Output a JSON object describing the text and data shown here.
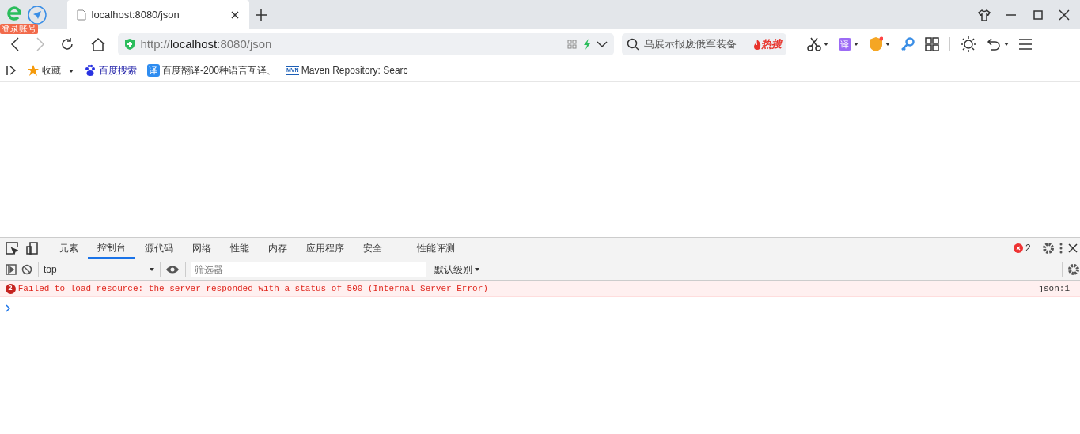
{
  "browser": {
    "account_badge": "登录账号",
    "tabs": [
      {
        "title": "localhost:8080/json",
        "selected": true
      }
    ],
    "address": {
      "prefix": "http://",
      "host": "localhost",
      "suffix": ":8080/json"
    },
    "search": {
      "placeholder": "乌展示报废俄军装备",
      "hot_label": "热搜"
    },
    "translate_glyph": "译",
    "bookmarks": [
      {
        "kind": "folder",
        "label": "收藏"
      },
      {
        "kind": "baidu",
        "label": "百度搜索"
      },
      {
        "kind": "translate",
        "icon_text": "译",
        "label": "百度翻译-200种语言互译、"
      },
      {
        "kind": "maven",
        "icon_text": "MVN",
        "label": "Maven Repository: Searc"
      }
    ]
  },
  "devtools": {
    "tabs": [
      {
        "label": "元素",
        "selected": false
      },
      {
        "label": "控制台",
        "selected": true
      },
      {
        "label": "源代码",
        "selected": false
      },
      {
        "label": "网络",
        "selected": false
      },
      {
        "label": "性能",
        "selected": false
      },
      {
        "label": "内存",
        "selected": false
      },
      {
        "label": "应用程序",
        "selected": false
      },
      {
        "label": "安全",
        "selected": false
      },
      {
        "label": "性能评测",
        "selected": false
      }
    ],
    "error_count": "2",
    "context": "top",
    "filter_placeholder": "筛选器",
    "level": "默认级别",
    "messages": [
      {
        "kind": "error",
        "count": "2",
        "text": "Failed to load resource: the server responded with a status of 500 (Internal Server Error)",
        "source": "json:1"
      }
    ]
  }
}
